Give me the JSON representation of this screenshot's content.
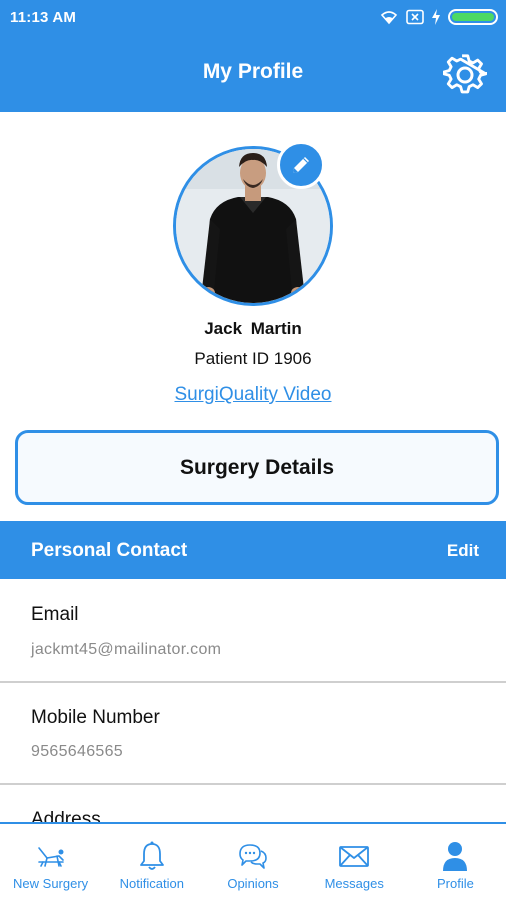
{
  "status_bar": {
    "time": "11:13 AM"
  },
  "header": {
    "title": "My Profile"
  },
  "profile": {
    "name": "Jack  Martin",
    "patient_id": "Patient ID 1906",
    "video_link": "SurgiQuality Video"
  },
  "surgery_details": {
    "label": "Surgery Details"
  },
  "personal_contact": {
    "title": "Personal Contact",
    "edit": "Edit",
    "fields": [
      {
        "label": "Email",
        "value": "jackmt45@mailinator.com"
      },
      {
        "label": "Mobile Number",
        "value": "9565646565"
      },
      {
        "label": "Address",
        "value": ""
      }
    ]
  },
  "tabs": [
    {
      "label": "New Surgery",
      "icon": "surgery-bed-icon"
    },
    {
      "label": "Notification",
      "icon": "bell-icon"
    },
    {
      "label": "Opinions",
      "icon": "chat-bubbles-icon"
    },
    {
      "label": "Messages",
      "icon": "envelope-icon"
    },
    {
      "label": "Profile",
      "icon": "person-icon"
    }
  ],
  "colors": {
    "primary": "#2f8fe6",
    "battery": "#4cd964",
    "muted_text": "#8a8a8a"
  }
}
